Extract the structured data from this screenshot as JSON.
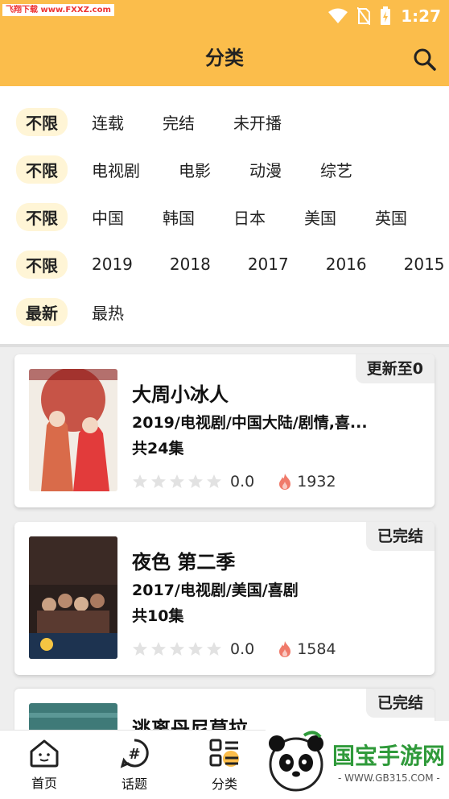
{
  "status_bar": {
    "watermark": "飞翔下载 www.FXXZ.com",
    "time": "1:27"
  },
  "header": {
    "title": "分类",
    "search_icon": "search-icon"
  },
  "filters": [
    {
      "active": "不限",
      "options": [
        "连载",
        "完结",
        "未开播"
      ]
    },
    {
      "active": "不限",
      "options": [
        "电视剧",
        "电影",
        "动漫",
        "综艺"
      ]
    },
    {
      "active": "不限",
      "options": [
        "中国",
        "韩国",
        "日本",
        "美国",
        "英国"
      ]
    },
    {
      "active": "不限",
      "options": [
        "2019",
        "2018",
        "2017",
        "2016",
        "2015"
      ]
    },
    {
      "active": "最新",
      "options": [
        "最热"
      ]
    }
  ],
  "items": [
    {
      "badge": "更新至0",
      "title": "大周小冰人",
      "meta": "2019/电视剧/中国大陆/剧情,喜...",
      "episodes": "共24集",
      "rating": "0.0",
      "stars": 0,
      "heat": "1932"
    },
    {
      "badge": "已完结",
      "title": "夜色 第二季",
      "meta": "2017/电视剧/美国/喜剧",
      "episodes": "共10集",
      "rating": "0.0",
      "stars": 0,
      "heat": "1584"
    },
    {
      "badge": "已完结",
      "title": "逃离丹尼莫拉"
    }
  ],
  "tabbar": [
    {
      "label": "首页",
      "icon": "home-icon"
    },
    {
      "label": "话题",
      "icon": "hashtag-icon"
    },
    {
      "label": "分类",
      "icon": "category-icon",
      "active": true
    }
  ],
  "watermark_bottom": {
    "brand": "国宝手游网",
    "url": "- WWW.GB315.COM -"
  },
  "colors": {
    "accent": "#fbbd4b",
    "active_chip": "#fff5d6",
    "fire": "#f07a6a",
    "star_empty": "#e2e2e2"
  }
}
